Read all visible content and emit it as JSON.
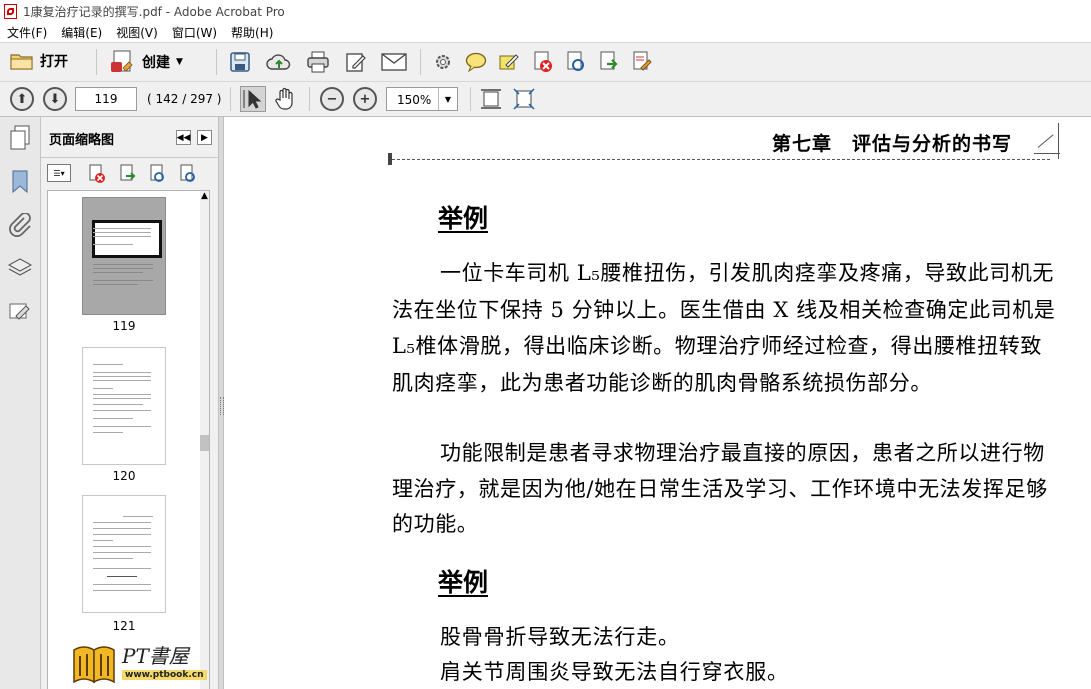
{
  "window": {
    "title": "1康复治疗记录的撰写.pdf - Adobe Acrobat Pro"
  },
  "menu": [
    "文件(F)",
    "编辑(E)",
    "视图(V)",
    "窗口(W)",
    "帮助(H)"
  ],
  "toolbar": {
    "open_label": "打开",
    "create_label": "创建"
  },
  "nav": {
    "page_value": "119",
    "page_count": "( 142 / 297 )",
    "zoom": "150%"
  },
  "panel": {
    "title": "页面缩略图",
    "thumbnails": [
      {
        "label": "119",
        "selected": true
      },
      {
        "label": "120",
        "selected": false
      },
      {
        "label": "121",
        "selected": false
      }
    ]
  },
  "document": {
    "running_head": "第七章　评估与分析的书写",
    "example1_heading": "举例",
    "para1": "一位卡车司机 L₅腰椎扭伤，引发肌肉痉挛及疼痛，导致此司机无法在坐位下保持 5 分钟以上。医生借由 X 线及相关检查确定此司机是 L₅椎体滑脱，得出临床诊断。物理治疗师经过检查，得出腰椎扭转致肌肉痉挛，此为患者功能诊断的肌肉骨骼系统损伤部分。",
    "para2": "功能限制是患者寻求物理治疗最直接的原因，患者之所以进行物理治疗，就是因为他/她在日常生活及学习、工作环境中无法发挥足够的功能。",
    "example2_heading": "举例",
    "item1": "股骨骨折导致无法行走。",
    "item2": "肩关节周围炎导致无法自行穿衣服。"
  },
  "watermark": {
    "text": "PT書屋",
    "url": "www.ptbook.cn"
  },
  "colors": {
    "toolbar_bg": "#f0f0f0",
    "pdf_red": "#cc0000",
    "selected_thumb": "#a0a0a0"
  }
}
